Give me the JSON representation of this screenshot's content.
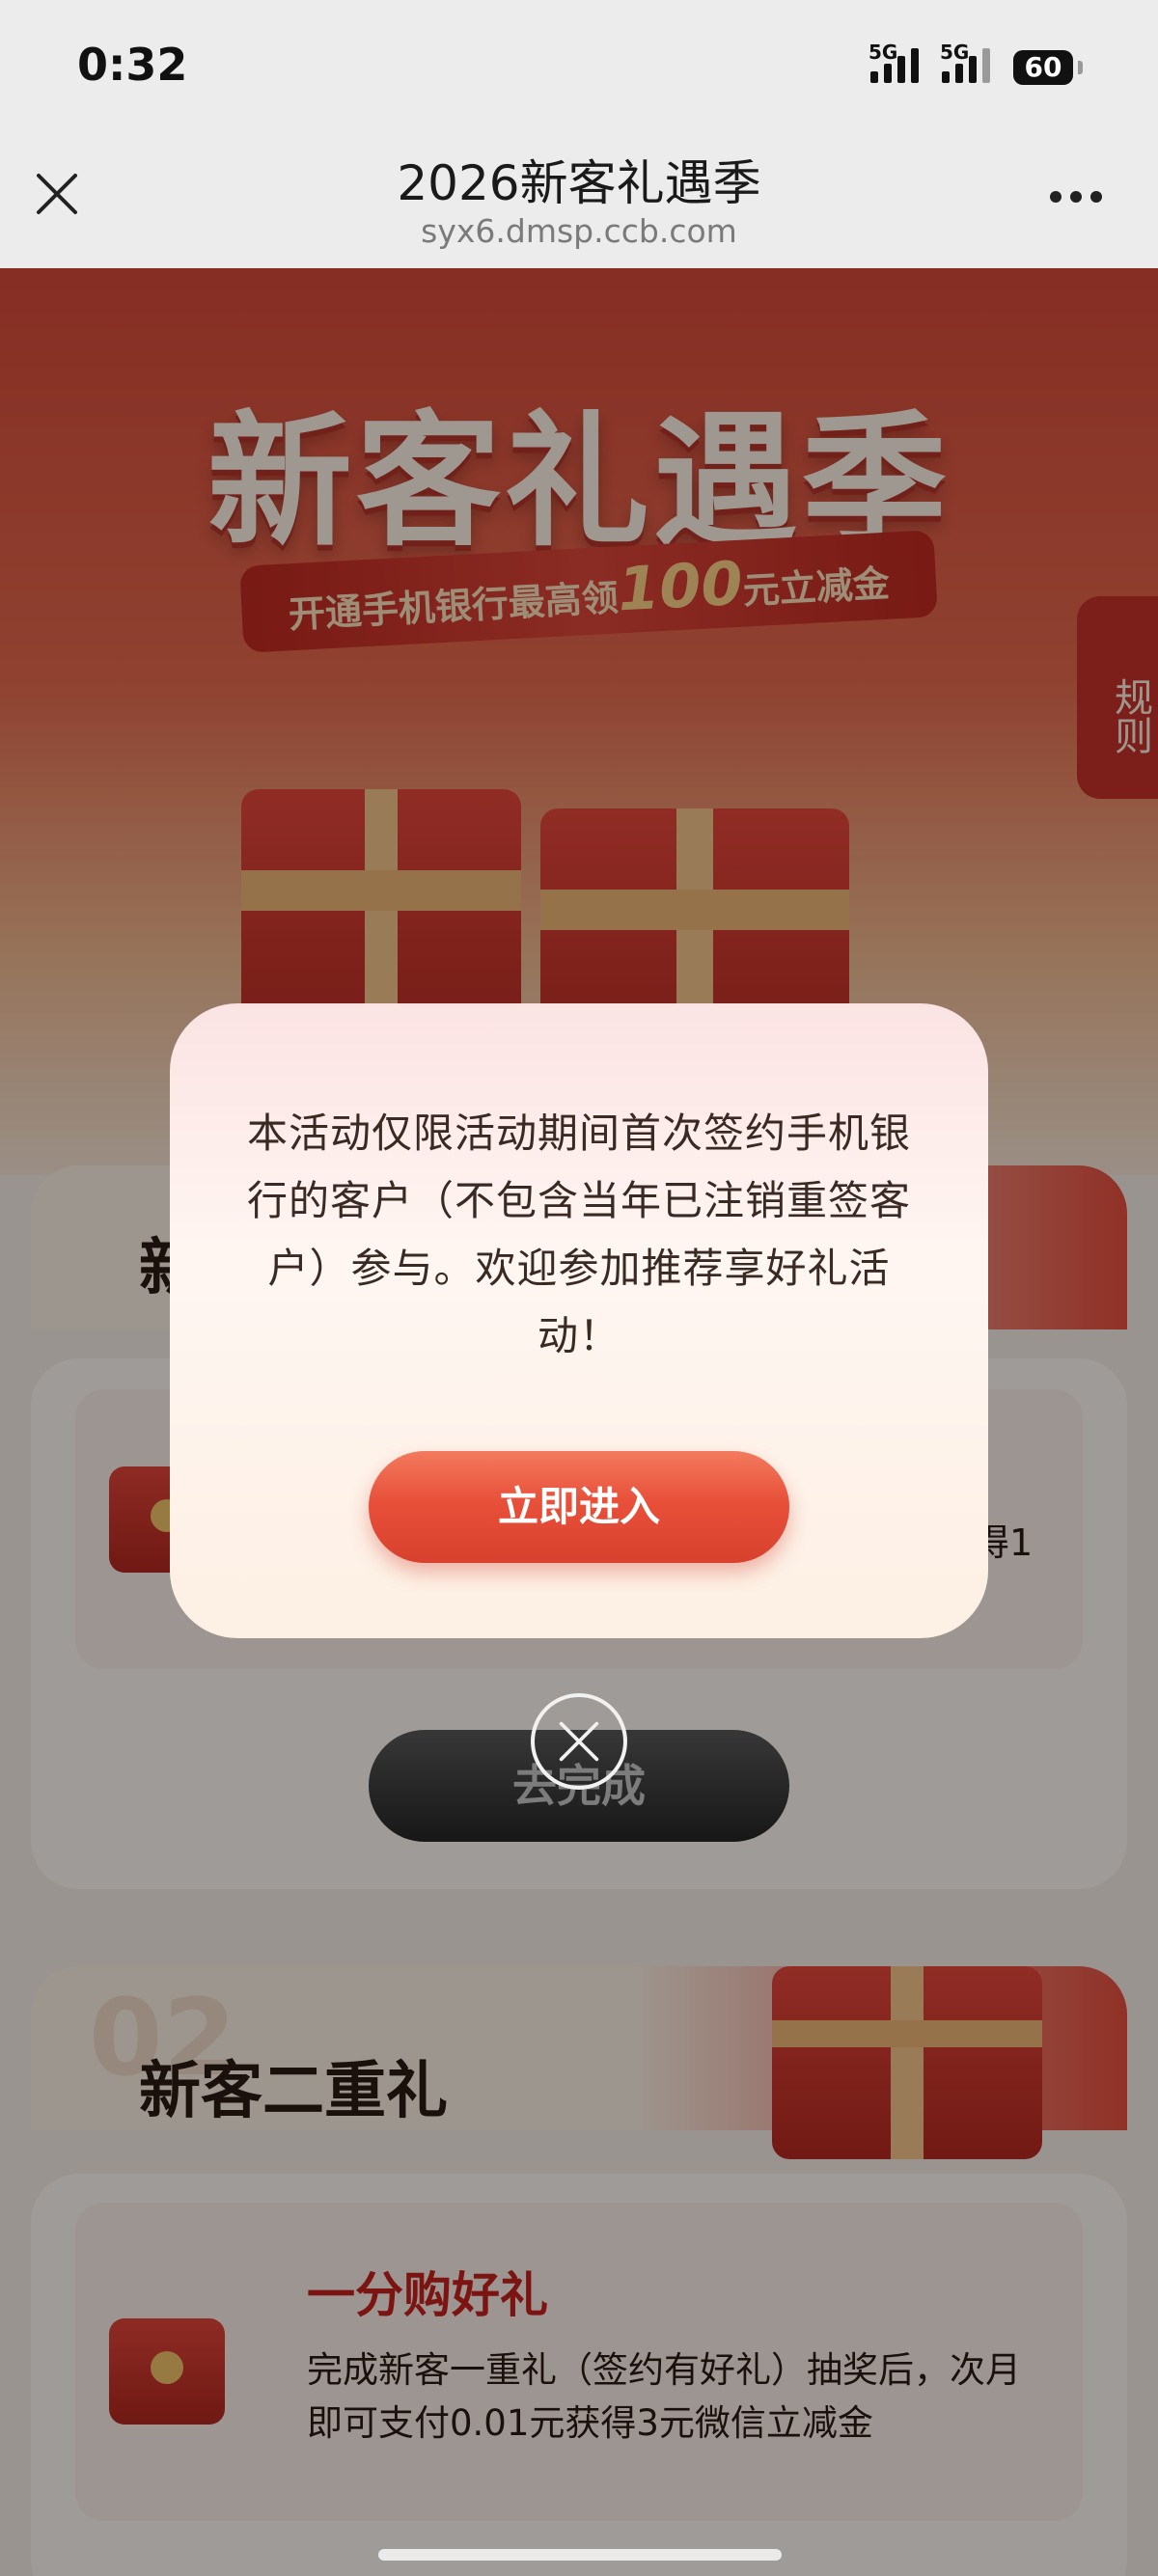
{
  "status_bar": {
    "time": "0:32",
    "signal1_label": "5G",
    "signal2_label": "5G",
    "battery": "60"
  },
  "nav": {
    "title": "2026新客礼遇季",
    "url": "syx6.dmsp.ccb.com"
  },
  "hero": {
    "title": "新客礼遇季",
    "ribbon_prefix": "开通手机银行最高领",
    "ribbon_amount": "100",
    "ribbon_suffix": "元立减金"
  },
  "rules_tab": {
    "label": "规则"
  },
  "section1": {
    "title_partial": "新",
    "button_label": "去完成",
    "desc_partial": "得1"
  },
  "section2": {
    "number": "02",
    "title": "新客二重礼",
    "card_title": "一分购好礼",
    "card_desc": "完成新客一重礼（签约有好礼）抽奖后，次月即可支付0.01元获得3元微信立减金"
  },
  "modal": {
    "message": "本活动仅限活动期间首次签约手机银行的客户（不包含当年已注销重签客户）参与。欢迎参加推荐享好礼活动！",
    "enter_button": "立即进入"
  },
  "colors": {
    "accent_red": "#e8503a",
    "title_red": "#c8231c",
    "overlay": "rgba(0,0,0,0.38)"
  }
}
